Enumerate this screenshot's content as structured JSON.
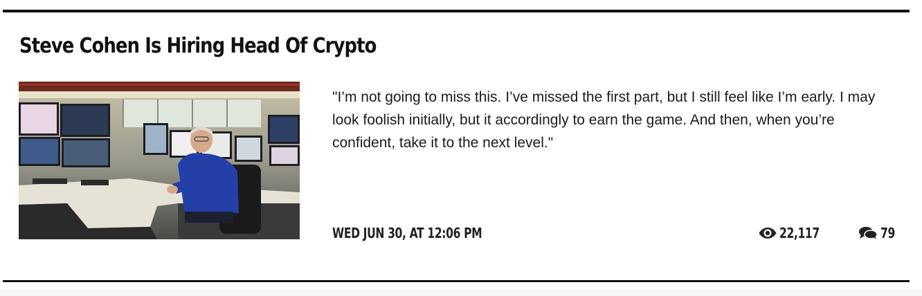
{
  "article": {
    "title": "Steve Cohen Is Hiring Head Of Crypto",
    "image_alt": "Man in blue sweater at a trading desk with many monitors",
    "excerpt": "\"I’m not going to miss this. I’ve missed the first part, but I still feel like I’m early. I may look foolish initially, but it accordingly to earn the game. And then, when you’re confident, take it to the next level.\"",
    "date": "WED JUN 30, AT 12:06 PM",
    "views": "22,117",
    "comments": "79",
    "icons": {
      "views": "eye-icon",
      "comments": "comments-icon"
    }
  }
}
